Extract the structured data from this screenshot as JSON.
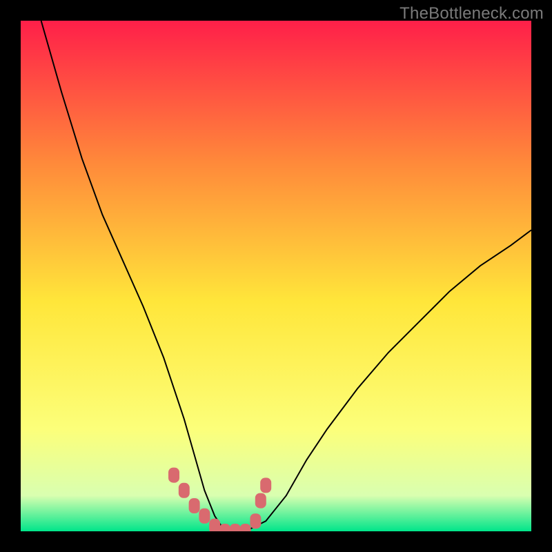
{
  "watermark": "TheBottleneck.com",
  "chart_data": {
    "type": "line",
    "title": "",
    "xlabel": "",
    "ylabel": "",
    "xlim": [
      0,
      100
    ],
    "ylim": [
      0,
      100
    ],
    "grid": false,
    "legend": false,
    "background_gradient": {
      "top": "#ff1f49",
      "mid_upper": "#ff8a3a",
      "mid": "#ffe63a",
      "mid_lower": "#fcff7a",
      "near_bottom": "#d9ffb0",
      "bottom": "#00e58a"
    },
    "series": [
      {
        "name": "bottleneck-curve",
        "color": "#000000",
        "stroke_width": 2,
        "x": [
          4,
          8,
          12,
          16,
          20,
          24,
          28,
          30,
          32,
          34,
          36,
          38,
          40,
          42,
          44,
          48,
          52,
          56,
          60,
          66,
          72,
          78,
          84,
          90,
          96,
          100
        ],
        "y": [
          100,
          86,
          73,
          62,
          53,
          44,
          34,
          28,
          22,
          15,
          8,
          3,
          0,
          0,
          0,
          2,
          7,
          14,
          20,
          28,
          35,
          41,
          47,
          52,
          56,
          59
        ]
      },
      {
        "name": "highlight-dots",
        "color": "#d96a6f",
        "marker": "round-rect",
        "x": [
          30,
          32,
          34,
          36,
          38,
          40,
          42,
          44,
          46,
          47,
          48
        ],
        "y": [
          11,
          8,
          5,
          3,
          1,
          0,
          0,
          0,
          2,
          6,
          9
        ]
      }
    ],
    "annotations": []
  }
}
